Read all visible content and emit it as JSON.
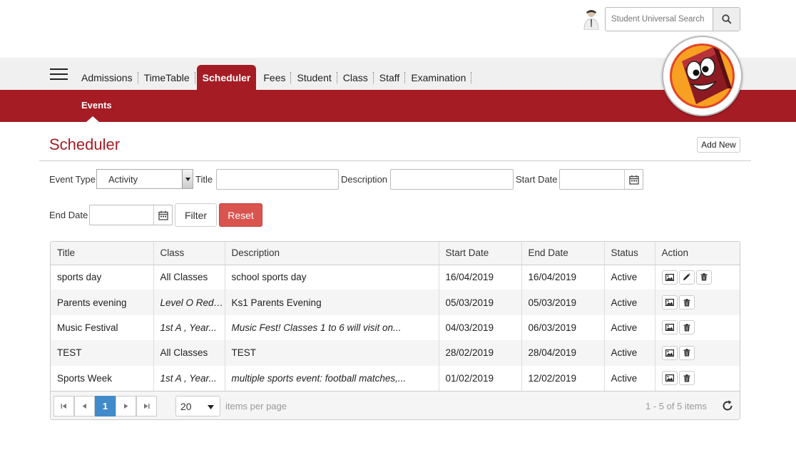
{
  "search": {
    "placeholder": "Student Universal Search"
  },
  "nav": {
    "items": [
      {
        "label": "Admissions",
        "active": false
      },
      {
        "label": "TimeTable",
        "active": false
      },
      {
        "label": "Scheduler",
        "active": true
      },
      {
        "label": "Fees",
        "active": false
      },
      {
        "label": "Student",
        "active": false
      },
      {
        "label": "Class",
        "active": false
      },
      {
        "label": "Staff",
        "active": false
      },
      {
        "label": "Examination",
        "active": false
      }
    ],
    "sub_item": "Events"
  },
  "page": {
    "title": "Scheduler",
    "add_new_label": "Add New"
  },
  "filters": {
    "event_type_label": "Event Type",
    "event_type_value": "Activity",
    "title_label": "Title",
    "description_label": "Description",
    "start_date_label": "Start Date",
    "end_date_label": "End Date",
    "filter_label": "Filter",
    "reset_label": "Reset"
  },
  "table": {
    "columns": [
      "Title",
      "Class",
      "Description",
      "Start Date",
      "End Date",
      "Status",
      "Action"
    ],
    "rows": [
      {
        "title": "sports day",
        "class": "All Classes",
        "class_italic": false,
        "description": "school sports day",
        "desc_italic": false,
        "start": "16/04/2019",
        "end": "16/04/2019",
        "status": "Active",
        "editable": true
      },
      {
        "title": "Parents evening",
        "class": "Level O Red ...",
        "class_italic": true,
        "description": "Ks1 Parents Evening",
        "desc_italic": false,
        "start": "05/03/2019",
        "end": "05/03/2019",
        "status": "Active",
        "editable": false
      },
      {
        "title": "Music Festival",
        "class": "1st A , Year...",
        "class_italic": true,
        "description": "Music Fest! Classes 1 to 6 will visit on...",
        "desc_italic": true,
        "start": "04/03/2019",
        "end": "06/03/2019",
        "status": "Active",
        "editable": false
      },
      {
        "title": "TEST",
        "class": "All Classes",
        "class_italic": false,
        "description": "TEST",
        "desc_italic": false,
        "start": "28/02/2019",
        "end": "28/04/2019",
        "status": "Active",
        "editable": false
      },
      {
        "title": "Sports Week",
        "class": "1st A , Year...",
        "class_italic": true,
        "description": "multiple sports event: football matches,...",
        "desc_italic": true,
        "start": "01/02/2019",
        "end": "12/02/2019",
        "status": "Active",
        "editable": false
      }
    ]
  },
  "pager": {
    "current_page": "1",
    "page_size": "20",
    "per_page_label": "items per page",
    "info": "1 - 5 of 5 items"
  },
  "colors": {
    "brand": "#a61c24",
    "reset": "#d9534f",
    "pager_active": "#428bca"
  }
}
